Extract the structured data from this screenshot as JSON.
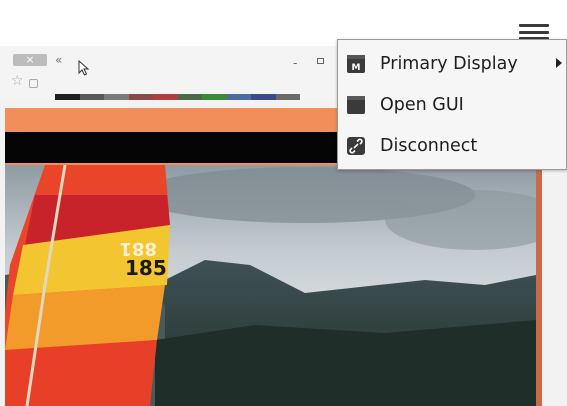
{
  "system_tray": {
    "icon": "hamburger-menu-icon"
  },
  "viewer": {
    "tab_close_glyph": "×",
    "tab_scroll_glyph": "«",
    "star_glyph": "☆",
    "minimize_glyph": "-",
    "swatch_colors": [
      "#202020",
      "#585858",
      "#7a7a7a",
      "#8a4a4a",
      "#b04040",
      "#4a6a4a",
      "#3a8a3a",
      "#4a6aa0",
      "#3a4a8a",
      "#6a6a6a"
    ]
  },
  "context_menu": {
    "items": [
      {
        "label": "Primary Display",
        "icon": "display-m-icon",
        "has_submenu": true
      },
      {
        "label": "Open GUI",
        "icon": "window-icon",
        "has_submenu": false
      },
      {
        "label": "Disconnect",
        "icon": "broken-link-icon",
        "has_submenu": false
      }
    ]
  },
  "stream": {
    "sail_numbers": [
      "881",
      "185"
    ]
  },
  "colors": {
    "stream_border": "#f28e5a",
    "menu_background": "#f6f6f6"
  }
}
